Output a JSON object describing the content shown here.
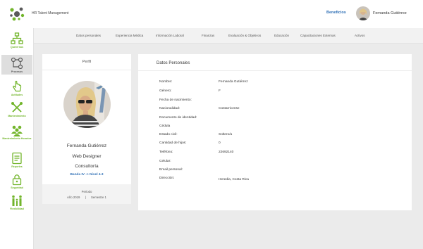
{
  "header": {
    "app_title": "HR Talent Management",
    "benefits_link": "Beneficios",
    "user_name": "Fernanda Gutiérrez",
    "accent_color": "#72b52b",
    "link_color": "#2e6fb5"
  },
  "sidebar": {
    "items": [
      {
        "label": "Querernos",
        "icon": "org-tree-icon",
        "active": false
      },
      {
        "label": "Procesos",
        "icon": "process-flow-icon",
        "active": true
      },
      {
        "label": "Actitudes",
        "icon": "hand-pointer-icon",
        "active": false
      },
      {
        "label": "Mantenimiento",
        "icon": "tools-icon",
        "active": false
      },
      {
        "label": "Mantenimiento Horarios",
        "icon": "people-group-icon",
        "active": false
      },
      {
        "label": "Reportes",
        "icon": "report-icon",
        "active": false
      },
      {
        "label": "Seguridad",
        "icon": "lock-icon",
        "active": false
      },
      {
        "label": "Flexibilidad",
        "icon": "family-icon",
        "active": false
      }
    ]
  },
  "tabs": [
    "Datos personales",
    "Experiencia Médica",
    "Información Laboral",
    "Finanzas",
    "Evaluación & Objetivos",
    "Educación",
    "Capacitaciones Externas",
    "Activos"
  ],
  "profile": {
    "heading": "Perfil",
    "name": "Fernanda Gutiérrez",
    "role": "Web Designer",
    "department": "Consultoría",
    "band": "Banda IV -> Nivel 4.3",
    "period_title": "Periodo",
    "year": "Año 2019",
    "separator": "|",
    "semester": "Semestre 1"
  },
  "personal_data": {
    "title": "Datos Personales",
    "fields": [
      {
        "label": "Nombre:",
        "value": "Fernanda Gutiérrez"
      },
      {
        "label": "Género:",
        "value": "F"
      },
      {
        "label": "Fecha de nacimiento:",
        "value": ""
      },
      {
        "label": "Nacionalidad:",
        "value": "Costarricense"
      },
      {
        "label": "Documento de identidad:",
        "value": ""
      },
      {
        "label": "Cédula",
        "value": ""
      },
      {
        "label": "Estado civil:",
        "value": "Soltero/a"
      },
      {
        "label": "Cantidad de hijos:",
        "value": "0"
      },
      {
        "label": "Teléfono:",
        "value": "22692140"
      },
      {
        "label": "Celular:",
        "value": ""
      },
      {
        "label": "Email personal:",
        "value": ""
      },
      {
        "label": "Dirección:",
        "value": "Heredia, Costa Rica"
      }
    ]
  }
}
